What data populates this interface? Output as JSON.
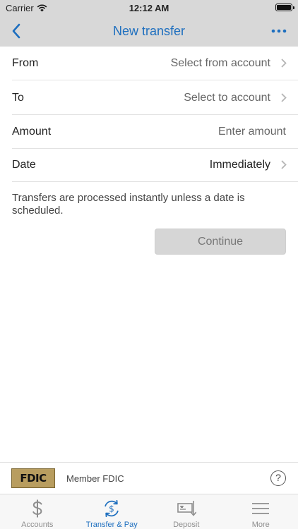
{
  "status_bar": {
    "carrier": "Carrier",
    "time": "12:12 AM"
  },
  "nav_bar": {
    "title": "New transfer",
    "back_icon": "chevron-left-icon",
    "more_icon": "ellipsis-icon"
  },
  "form": {
    "rows": [
      {
        "label": "From",
        "value": "Select from account"
      },
      {
        "label": "To",
        "value": "Select to account"
      },
      {
        "label": "Amount",
        "placeholder": "Enter amount"
      },
      {
        "label": "Date",
        "value": "Immediately"
      }
    ],
    "note": "Transfers are processed instantly unless a date is scheduled.",
    "continue_label": "Continue"
  },
  "footer": {
    "logo_text": "FDIC",
    "member_text": "Member FDIC",
    "help_label": "?"
  },
  "tab_bar": {
    "tabs": [
      {
        "label": "Accounts",
        "icon": "dollar-icon"
      },
      {
        "label": "Transfer & Pay",
        "icon": "transfer-dollar-icon",
        "active": true
      },
      {
        "label": "Deposit",
        "icon": "deposit-check-icon"
      },
      {
        "label": "More",
        "icon": "menu-icon"
      }
    ]
  },
  "colors": {
    "accent": "#1e6fbf",
    "bar_bg": "#d8d8d8",
    "button_disabled": "#d6d6d6"
  }
}
